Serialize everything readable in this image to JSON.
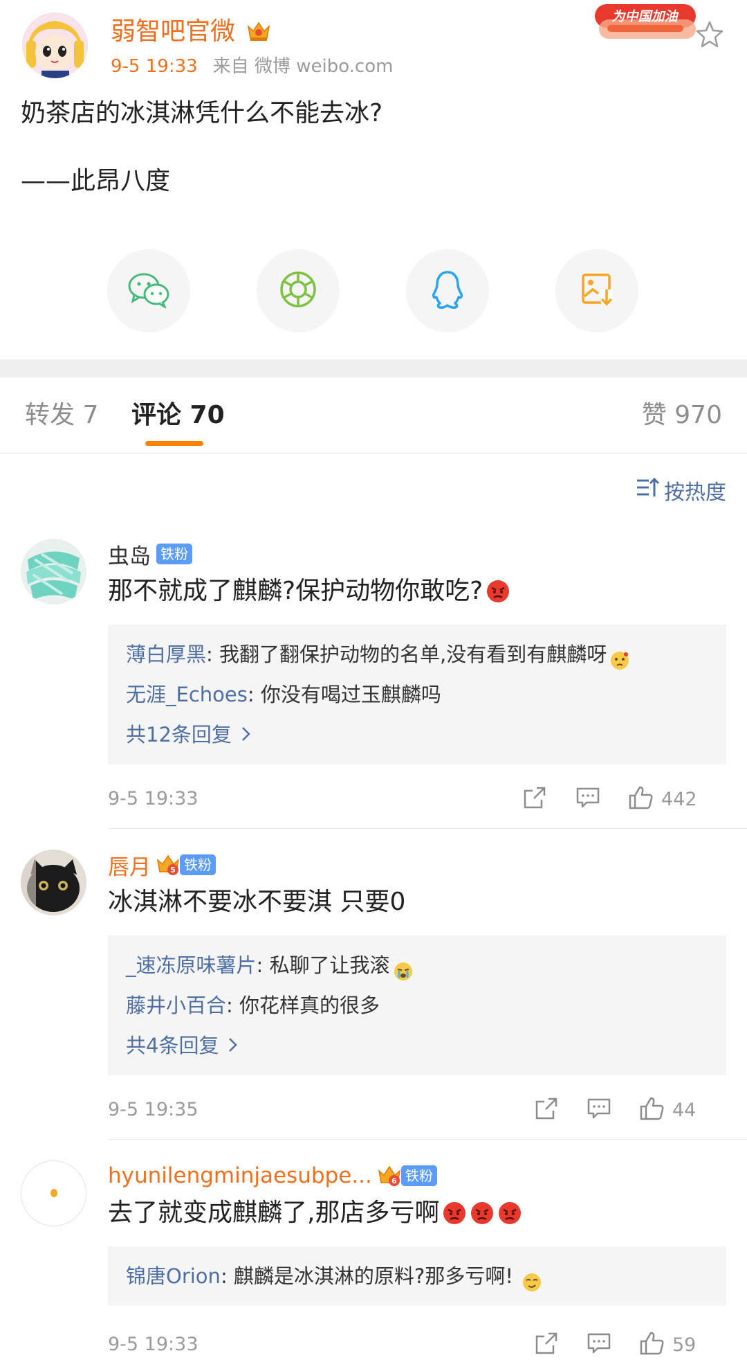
{
  "post": {
    "author": "弱智吧官微",
    "time": "9-5 19:33",
    "source": "来自 微博 weibo.com",
    "promo_badge": "为中国加油",
    "content": [
      "奶茶店的冰淇淋凭什么不能去冰?",
      "——此昂八度"
    ]
  },
  "share": {
    "icons": [
      "wechat-icon",
      "moments-icon",
      "qq-icon",
      "save-image-icon"
    ]
  },
  "tabs": {
    "repost": "转发 7",
    "comment": "评论 70",
    "like": "赞 970"
  },
  "sort": {
    "label": "按热度"
  },
  "comments": [
    {
      "user": "虫岛",
      "badge": "铁粉",
      "text": "那不就成了麒麟?保护动物你敢吃?",
      "emoji": "angry-emoji",
      "replies": [
        {
          "user": "薄白厚黑",
          "text": ": 我翻了翻保护动物的名单,没有看到有麒麟呀",
          "emoji": "thinking-emoji"
        },
        {
          "user": "无涯_Echoes",
          "text": ": 你没有喝过玉麒麟吗"
        }
      ],
      "more": "共12条回复",
      "time": "9-5 19:33",
      "likes": "442"
    },
    {
      "user": "唇月",
      "badge": "铁粉",
      "crown_level": "5",
      "text": "冰淇淋不要冰不要淇 只要0",
      "replies": [
        {
          "user": "_速冻原味薯片",
          "text": ": 私聊了让我滚",
          "emoji": "crying-emoji"
        },
        {
          "user": "藤井小百合",
          "text": ": 你花样真的很多"
        }
      ],
      "more": "共4条回复",
      "time": "9-5 19:35",
      "likes": "44"
    },
    {
      "user": "hyunilengminjaesubpe...",
      "badge": "铁粉",
      "crown_level": "6",
      "text": "去了就变成麒麟了,那店多亏啊",
      "emoji": "angry-emoji",
      "replies": [
        {
          "user": "锦唐Orion",
          "text": ": 麒麟是冰淇淋的原料?那多亏啊!",
          "emoji": "smirk-emoji"
        }
      ],
      "time": "9-5 19:33",
      "likes": "59"
    }
  ],
  "colors": {
    "accent": "#f26e1a",
    "link": "#4e6fa3",
    "tab_underline": "#ff8200",
    "fan_badge": "#5a9cf8"
  }
}
